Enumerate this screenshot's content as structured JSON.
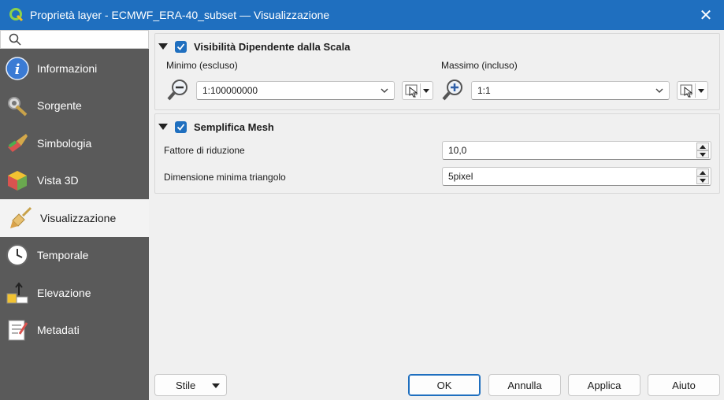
{
  "window": {
    "title": "Proprietà layer - ECMWF_ERA-40_subset — Visualizzazione",
    "close_icon": "close-icon",
    "colors": {
      "titlebar": "#1f6fbf",
      "sidebar": "#5a5a5a",
      "accent": "#1f6fbf"
    }
  },
  "sidebar": {
    "search_placeholder": "",
    "items": [
      {
        "label": "Informazioni",
        "icon": "info-icon"
      },
      {
        "label": "Sorgente",
        "icon": "source-wrench-icon"
      },
      {
        "label": "Simbologia",
        "icon": "symbology-brush-icon"
      },
      {
        "label": "Vista 3D",
        "icon": "cube-3d-icon"
      },
      {
        "label": "Visualizzazione",
        "icon": "paintbrush-icon",
        "active": true
      },
      {
        "label": "Temporale",
        "icon": "clock-icon"
      },
      {
        "label": "Elevazione",
        "icon": "elevation-icon"
      },
      {
        "label": "Metadati",
        "icon": "metadata-notepad-icon"
      }
    ]
  },
  "scale_visibility": {
    "title": "Visibilità Dipendente dalla Scala",
    "checked": true,
    "min_label": "Minimo (escluso)",
    "min_value": "1:100000000",
    "max_label": "Massimo (incluso)",
    "max_value": "1:1"
  },
  "simplify_mesh": {
    "title": "Semplifica Mesh",
    "checked": true,
    "reduction_label": "Fattore di riduzione",
    "reduction_value": "10,0",
    "min_triangle_label": "Dimensione minima triangolo",
    "min_triangle_value": "5pixel"
  },
  "buttons": {
    "stile": "Stile",
    "ok": "OK",
    "cancel": "Annulla",
    "apply": "Applica",
    "help": "Aiuto"
  }
}
